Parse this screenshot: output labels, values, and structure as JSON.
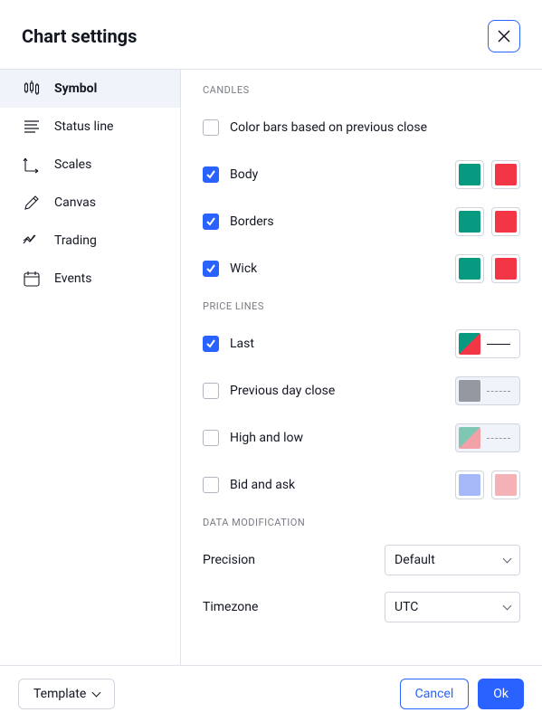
{
  "title": "Chart settings",
  "sidebar": {
    "items": [
      {
        "label": "Symbol",
        "active": true
      },
      {
        "label": "Status line",
        "active": false
      },
      {
        "label": "Scales",
        "active": false
      },
      {
        "label": "Canvas",
        "active": false
      },
      {
        "label": "Trading",
        "active": false
      },
      {
        "label": "Events",
        "active": false
      }
    ]
  },
  "sections": {
    "candles": {
      "title": "CANDLES",
      "color_on_prev_close": {
        "label": "Color bars based on previous close",
        "checked": false
      },
      "body": {
        "label": "Body",
        "checked": true,
        "colors": [
          "#089981",
          "#f23645"
        ]
      },
      "borders": {
        "label": "Borders",
        "checked": true,
        "colors": [
          "#089981",
          "#f23645"
        ]
      },
      "wick": {
        "label": "Wick",
        "checked": true,
        "colors": [
          "#089981",
          "#f23645"
        ]
      }
    },
    "price_lines": {
      "title": "PRICE LINES",
      "last": {
        "label": "Last",
        "checked": true,
        "split": [
          "#089981",
          "#f23645"
        ],
        "line": "solid",
        "line_color": "#131722"
      },
      "prev_close": {
        "label": "Previous day close",
        "checked": false,
        "color": "#9598a1",
        "line": "dashed",
        "line_color": "#9598a1"
      },
      "high_low": {
        "label": "High and low",
        "checked": false,
        "split": [
          "#5fbfa5",
          "#f28a93"
        ],
        "line": "dashed",
        "line_color": "#9598a1"
      },
      "bid_ask": {
        "label": "Bid and ask",
        "checked": false,
        "colors": [
          "#a7b8f8",
          "#f4b1b6"
        ]
      }
    },
    "data_mod": {
      "title": "DATA MODIFICATION",
      "precision": {
        "label": "Precision",
        "value": "Default"
      },
      "timezone": {
        "label": "Timezone",
        "value": "UTC"
      }
    }
  },
  "footer": {
    "template": "Template",
    "cancel": "Cancel",
    "ok": "Ok"
  }
}
